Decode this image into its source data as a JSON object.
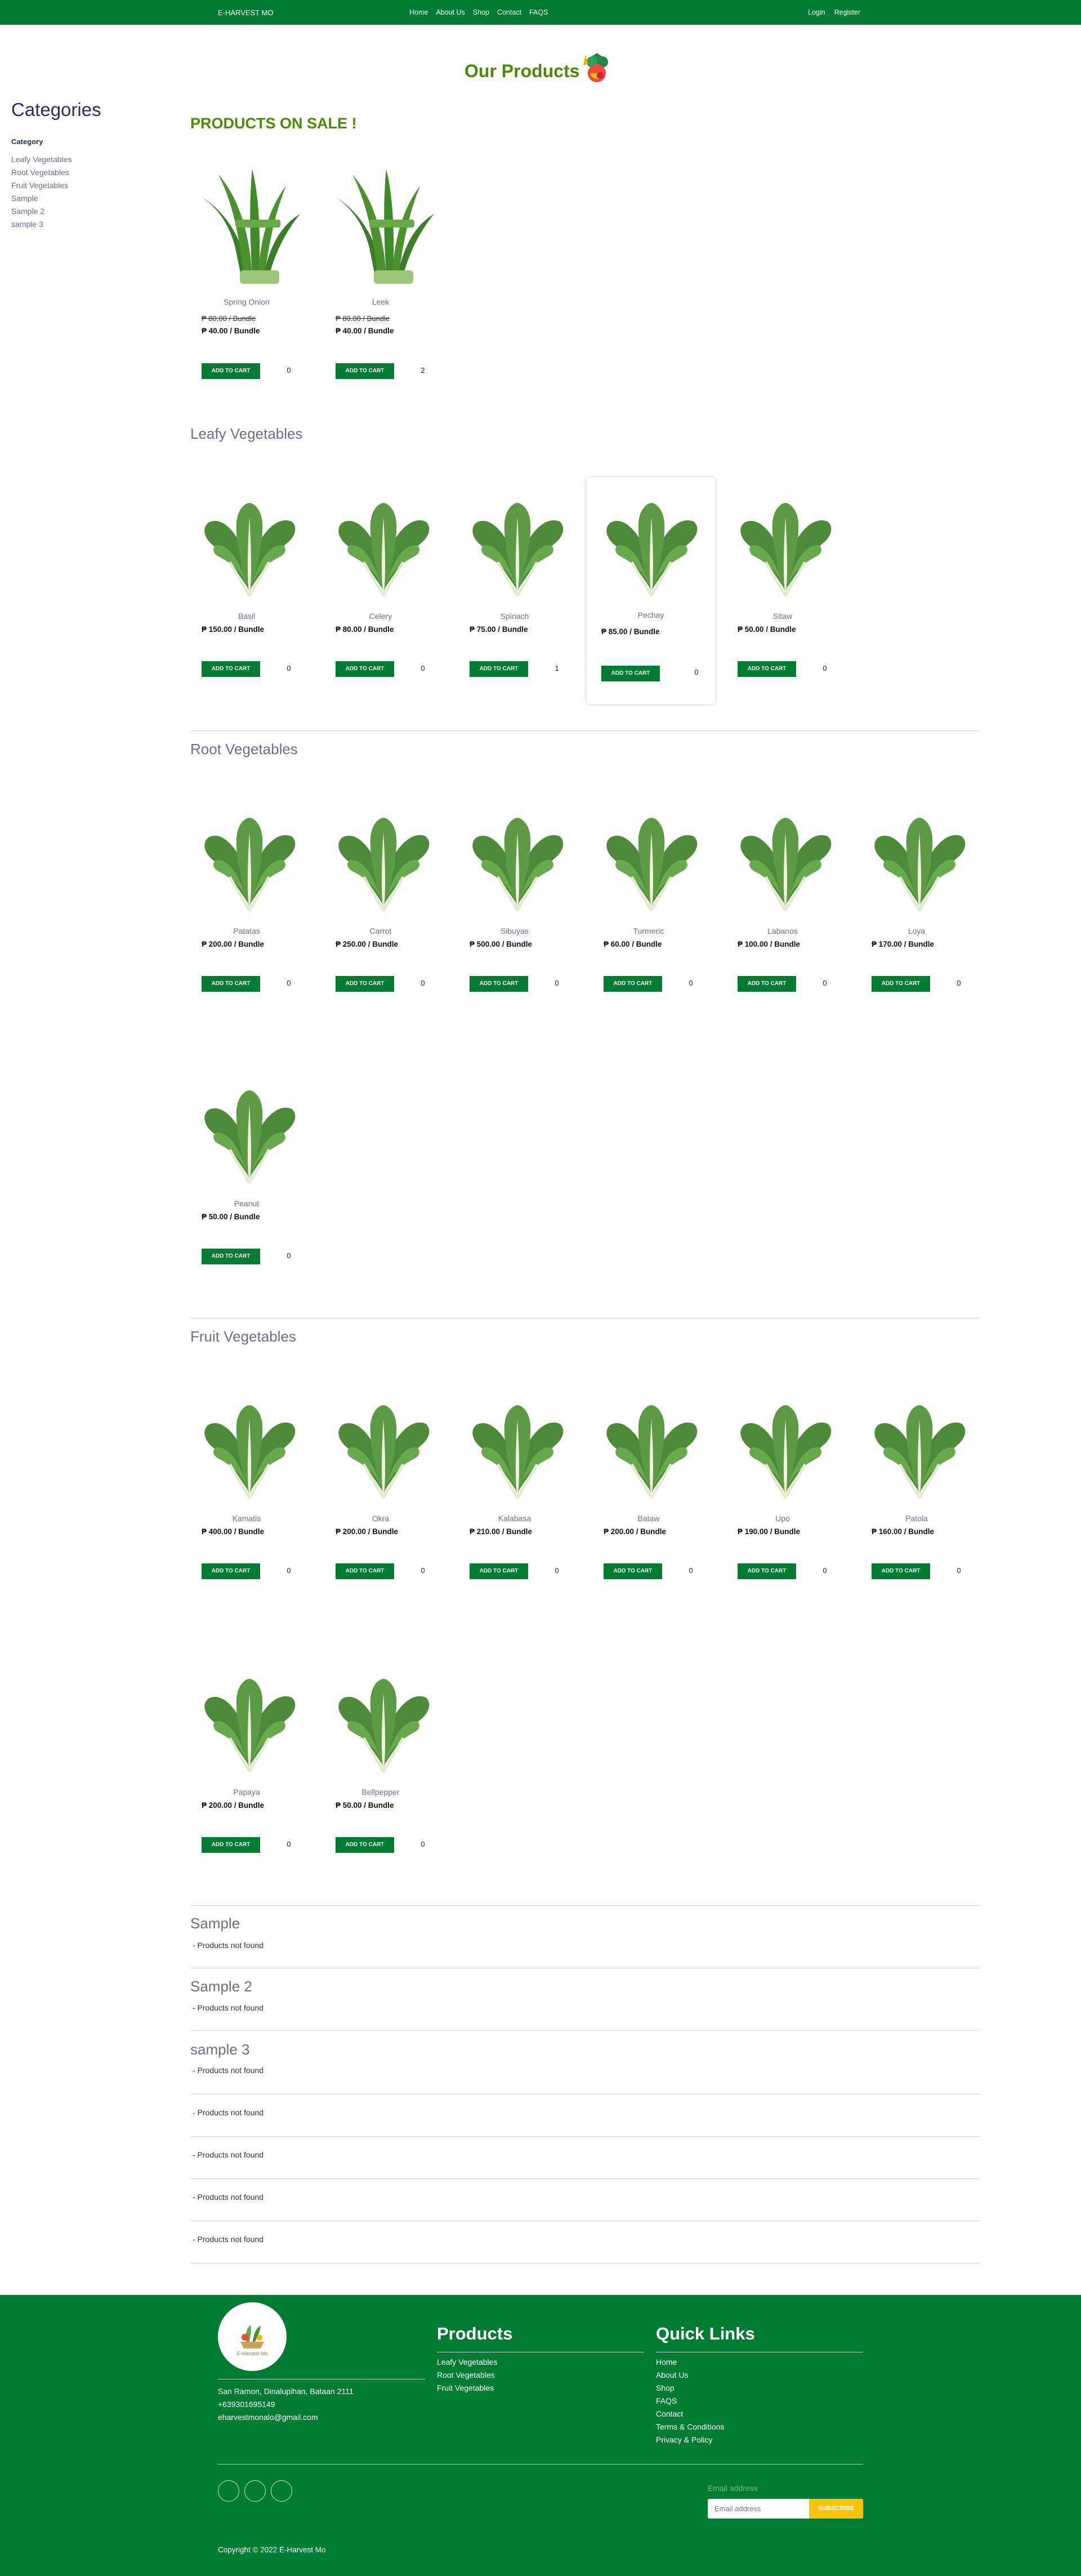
{
  "header": {
    "brand": "E-HARVEST MO",
    "nav": [
      "Home",
      "About Us",
      "Shop",
      "Contact",
      "FAQS"
    ],
    "auth": [
      "Login",
      "Register"
    ]
  },
  "page": {
    "title": "Our Products"
  },
  "sidebar": {
    "heading": "Categories",
    "category_label": "Category",
    "items": [
      "Leafy Vegetables",
      "Root Vegetables",
      "Fruit Vegetables",
      "Sample",
      "Sample 2",
      "sample 3"
    ]
  },
  "sale": {
    "heading": "PRODUCTS ON SALE !",
    "products": [
      {
        "name": "Spring Onion",
        "old_price": "₱ 80.00 / Bundle",
        "price": "₱ 40.00 / Bundle",
        "qty": "0"
      },
      {
        "name": "Leek",
        "old_price": "₱ 80.00 / Bundle",
        "price": "₱ 40.00 / Bundle",
        "qty": "2"
      }
    ]
  },
  "add_to_cart_label": "ADD TO CART",
  "leafy": {
    "heading": "Leafy Vegetables",
    "products": [
      {
        "name": "Basil",
        "price": "₱ 150.00 / Bundle",
        "qty": "0"
      },
      {
        "name": "Celery",
        "price": "₱ 80.00 / Bundle",
        "qty": "0"
      },
      {
        "name": "Spinach",
        "price": "₱ 75.00 / Bundle",
        "qty": "1"
      },
      {
        "name": "Pechay",
        "price": "₱ 85.00 / Bundle",
        "qty": "0"
      },
      {
        "name": "Sitaw",
        "price": "₱ 50.00 / Bundle",
        "qty": "0"
      }
    ]
  },
  "root": {
    "heading": "Root Vegetables",
    "products": [
      {
        "name": "Patatas",
        "price": "₱ 200.00 / Bundle",
        "qty": "0"
      },
      {
        "name": "Carrot",
        "price": "₱ 250.00 / Bundle",
        "qty": "0"
      },
      {
        "name": "Sibuyas",
        "price": "₱ 500.00 / Bundle",
        "qty": "0"
      },
      {
        "name": "Turmeric",
        "price": "₱ 60.00 / Bundle",
        "qty": "0"
      },
      {
        "name": "Labanos",
        "price": "₱ 100.00 / Bundle",
        "qty": "0"
      },
      {
        "name": "Loya",
        "price": "₱ 170.00 / Bundle",
        "qty": "0"
      },
      {
        "name": "Peanut",
        "price": "₱ 50.00 / Bundle",
        "qty": "0"
      }
    ]
  },
  "fruit": {
    "heading": "Fruit Vegetables",
    "products": [
      {
        "name": "Kamatis",
        "price": "₱ 400.00 / Bundle",
        "qty": "0"
      },
      {
        "name": "Okra",
        "price": "₱ 200.00 / Bundle",
        "qty": "0"
      },
      {
        "name": "Kalabasa",
        "price": "₱ 210.00 / Bundle",
        "qty": "0"
      },
      {
        "name": "Bataw",
        "price": "₱ 200.00 / Bundle",
        "qty": "0"
      },
      {
        "name": "Upo",
        "price": "₱ 190.00 / Bundle",
        "qty": "0"
      },
      {
        "name": "Patola",
        "price": "₱ 160.00 / Bundle",
        "qty": "0"
      },
      {
        "name": "Papaya",
        "price": "₱ 200.00 / Bundle",
        "qty": "0"
      },
      {
        "name": "Bellpepper",
        "price": "₱ 50.00 / Bundle",
        "qty": "0"
      }
    ]
  },
  "empty_sections": [
    {
      "heading": "Sample",
      "message": "- Products not found"
    },
    {
      "heading": "Sample 2",
      "message": "- Products not found"
    },
    {
      "heading": "sample 3",
      "message": "- Products not found"
    },
    {
      "heading": "",
      "message": "- Products not found"
    },
    {
      "heading": "",
      "message": "- Products not found"
    },
    {
      "heading": "",
      "message": "- Products not found"
    },
    {
      "heading": "",
      "message": "- Products not found"
    }
  ],
  "footer": {
    "logo_text": "E-Harvest Mo",
    "address": "San Ramon, Dinalupihan, Bataan 2111",
    "phone": "+639301695149",
    "email": "eharvestmonalo@gmail.com",
    "products_heading": "Products",
    "products_links": [
      "Leafy Vegetables",
      "Root Vegetables",
      "Fruit Vegetables"
    ],
    "quick_heading": "Quick Links",
    "quick_links": [
      "Home",
      "About Us",
      "Shop",
      "FAQS",
      "Contact",
      "Terms & Conditions",
      "Privacy & Policy"
    ],
    "email_label": "Email address",
    "email_placeholder": "Email address",
    "subscribe_label": "SUBSCRIBE",
    "copyright": "Copyright © 2022 E-Harvest Mo"
  },
  "colors": {
    "brand_green": "#037c33",
    "title_green": "#4b8a06",
    "subscribe_yellow": "#f6c20b"
  }
}
